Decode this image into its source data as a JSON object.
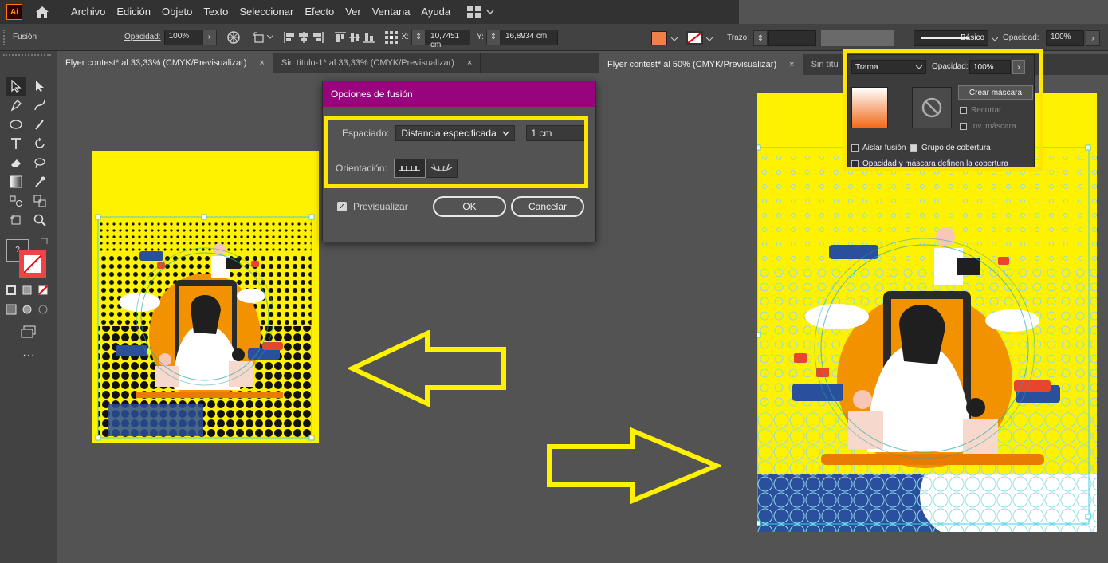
{
  "app": {
    "logo": "Ai"
  },
  "menu": [
    "Archivo",
    "Edición",
    "Objeto",
    "Texto",
    "Seleccionar",
    "Efecto",
    "Ver",
    "Ventana",
    "Ayuda"
  ],
  "control_left": {
    "blend_label": "Fusión",
    "opacity_label": "Opacidad:",
    "opacity_value": "100%",
    "x_label": "X:",
    "x_value": "10,7451 cm",
    "y_label": "Y:",
    "y_value": "16,8934 cm"
  },
  "control_right": {
    "stroke_label": "Trazo:",
    "style_label": "Básico",
    "opacity_label": "Opacidad:",
    "opacity_value": "100%",
    "fill_color": "#f0804a"
  },
  "tabs_left": [
    {
      "label": "Flyer contest* al 33,33% (CMYK/Previsualizar)",
      "close": "×"
    },
    {
      "label": "Sin título-1* al 33,33% (CMYK/Previsualizar)",
      "close": "×"
    }
  ],
  "tabs_right": [
    {
      "label": "Flyer contest* al 50% (CMYK/Previsualizar)",
      "close": "×"
    },
    {
      "label": "Sin títu",
      "close": ""
    }
  ],
  "dialog": {
    "title": "Opciones de fusión",
    "spacing_label": "Espaciado:",
    "spacing_value": "Distancia especificada",
    "distance_value": "1 cm",
    "orientation_label": "Orientación:",
    "preview_label": "Previsualizar",
    "ok_label": "OK",
    "cancel_label": "Cancelar"
  },
  "transparency_panel": {
    "mode": "Trama",
    "opacity_label": "Opacidad:",
    "opacity_value": "100%",
    "make_mask_label": "Crear máscara",
    "clip_label": "Recortar",
    "invert_label": "Inv. máscara",
    "isolate_label": "Aislar fusión",
    "knockout_label": "Grupo de cobertura",
    "define_label": "Opacidad y máscara definen la cobertura"
  },
  "colors": {
    "highlight": "#ffe600",
    "artboard": "#fff200",
    "dialog_title": "#97047e",
    "accent_blue": "#2a4f9c"
  }
}
